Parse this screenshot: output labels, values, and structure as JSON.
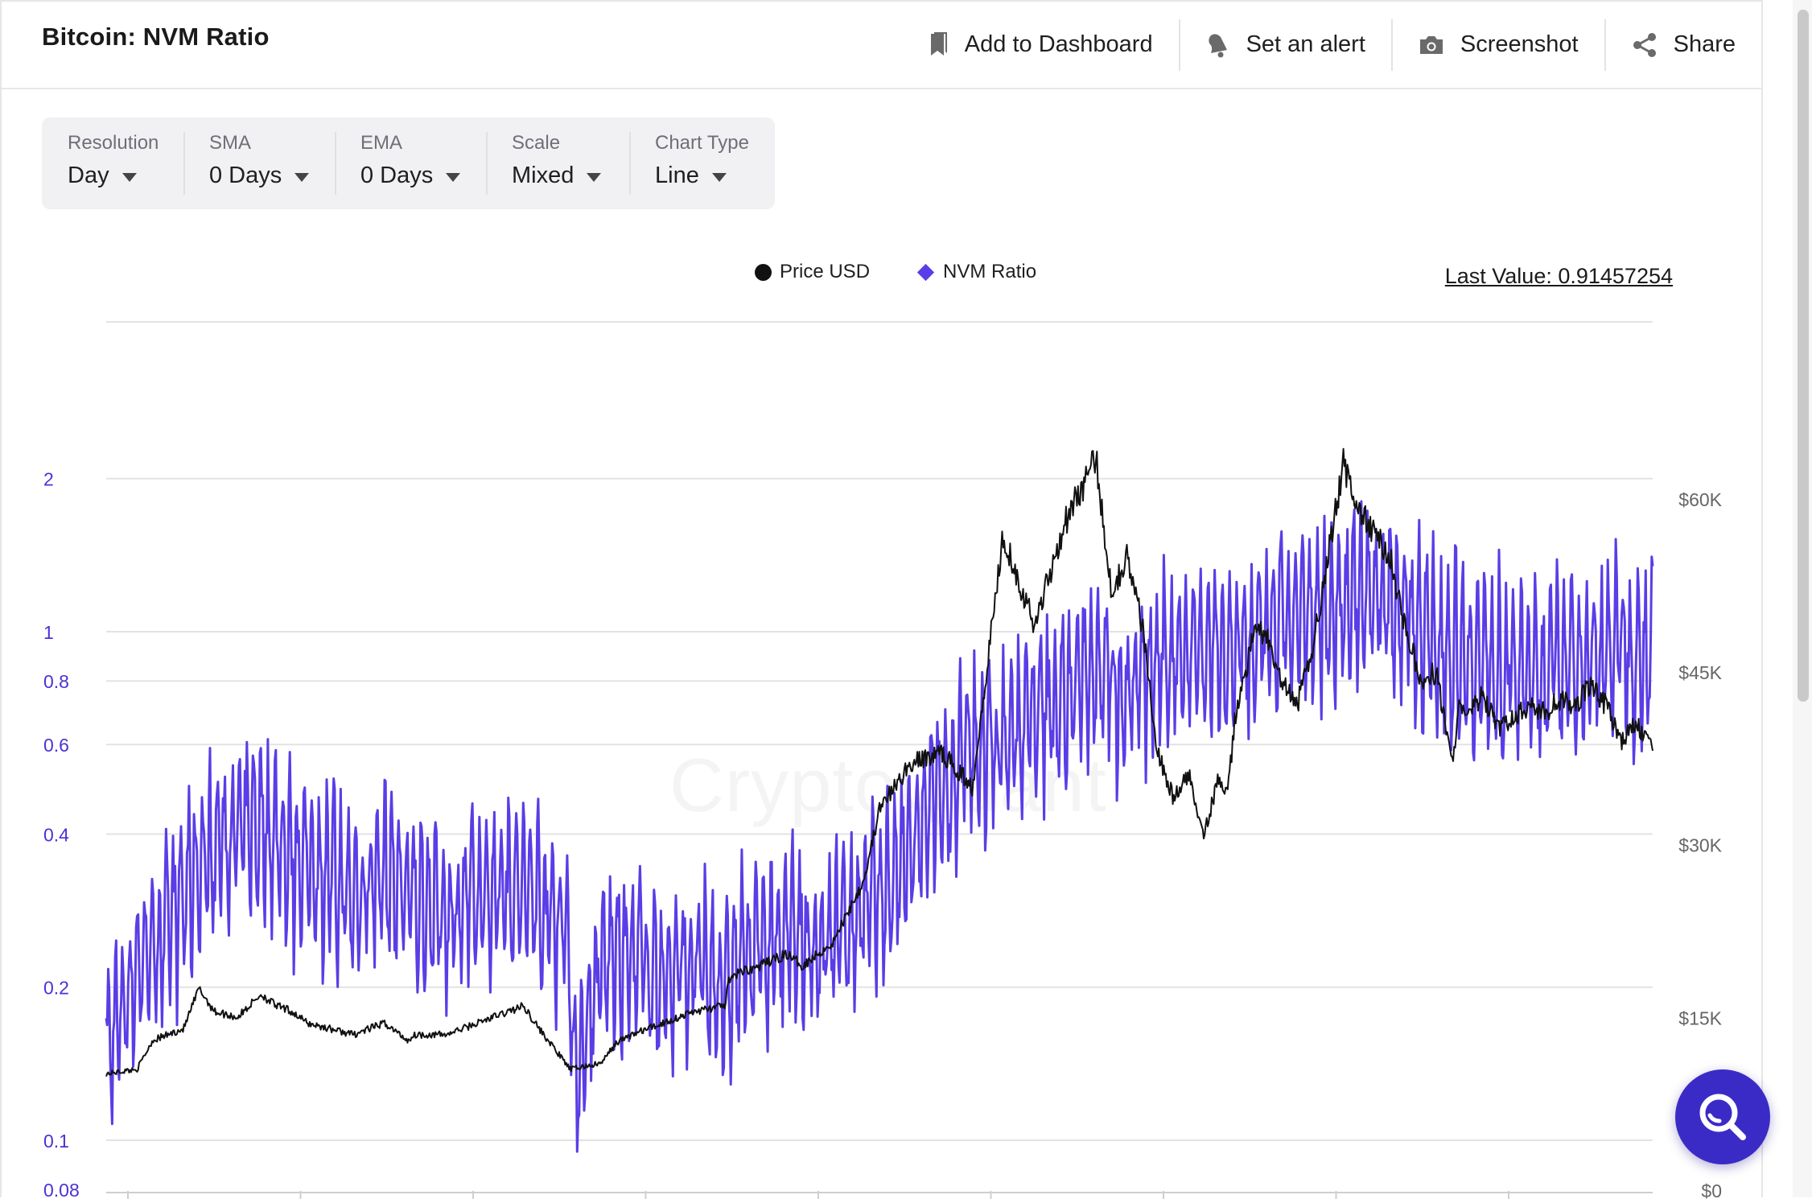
{
  "header": {
    "title": "Bitcoin: NVM Ratio",
    "actions": [
      {
        "label": "Add to Dashboard",
        "icon": "bookmark-icon"
      },
      {
        "label": "Set an alert",
        "icon": "bell-icon"
      },
      {
        "label": "Screenshot",
        "icon": "camera-icon"
      },
      {
        "label": "Share",
        "icon": "share-icon"
      }
    ]
  },
  "controls": [
    {
      "label": "Resolution",
      "value": "Day"
    },
    {
      "label": "SMA",
      "value": "0 Days"
    },
    {
      "label": "EMA",
      "value": "0 Days"
    },
    {
      "label": "Scale",
      "value": "Mixed"
    },
    {
      "label": "Chart Type",
      "value": "Line"
    }
  ],
  "legend": {
    "price": "Price USD",
    "nvm": "NVM Ratio"
  },
  "last_value": "Last Value: 0.91457254",
  "watermark": "CryptoQuant",
  "colors": {
    "nvm": "#5a3de6",
    "price": "#111111",
    "axis_left": "#4a32d6",
    "axis_right": "#666666",
    "grid": "#e3e3e3",
    "fab": "#3b2bc6"
  },
  "chart_data": {
    "type": "line",
    "scale": "mixed",
    "left_axis": {
      "scale": "log",
      "ticks": [
        0.08,
        0.1,
        0.2,
        0.4,
        0.6,
        0.8,
        1,
        2
      ],
      "labels": [
        "0.08",
        "0.1",
        "0.2",
        "0.4",
        "0.6",
        "0.8",
        "1",
        "2"
      ]
    },
    "right_axis": {
      "scale": "linear",
      "ticks": [
        0,
        15000,
        30000,
        45000,
        60000
      ],
      "labels": [
        "$0",
        "$15K",
        "$30K",
        "$45K",
        "$60K"
      ],
      "range": [
        0,
        60000
      ]
    },
    "grid": true,
    "series": [
      {
        "name": "Price USD",
        "axis": "right",
        "x": [
          0,
          0.02,
          0.03,
          0.05,
          0.06,
          0.065,
          0.07,
          0.085,
          0.1,
          0.11,
          0.12,
          0.13,
          0.145,
          0.16,
          0.18,
          0.195,
          0.2,
          0.22,
          0.24,
          0.27,
          0.28,
          0.3,
          0.32,
          0.33,
          0.34,
          0.36,
          0.37,
          0.38,
          0.4,
          0.402,
          0.41,
          0.42,
          0.44,
          0.45,
          0.47,
          0.49,
          0.5,
          0.52,
          0.54,
          0.56,
          0.58,
          0.6,
          0.62,
          0.64,
          0.65,
          0.66,
          0.67,
          0.68,
          0.69,
          0.7,
          0.71,
          0.72,
          0.725,
          0.73,
          0.74,
          0.745,
          0.75,
          0.76,
          0.77,
          0.78,
          0.79,
          0.8,
          0.81,
          0.82,
          0.83,
          0.84,
          0.85,
          0.86,
          0.87,
          0.875,
          0.88,
          0.89,
          0.9,
          0.91,
          0.92,
          0.93,
          0.94,
          0.95,
          0.96,
          0.97,
          0.98,
          0.99,
          1.0
        ],
        "values": [
          10100,
          10500,
          13000,
          14000,
          17500,
          16500,
          15500,
          15000,
          17000,
          16000,
          15500,
          14500,
          14000,
          13500,
          14500,
          13000,
          13500,
          13500,
          14500,
          16000,
          14000,
          10500,
          11000,
          12800,
          13500,
          14500,
          15000,
          15500,
          16000,
          18000,
          19000,
          19300,
          20500,
          19500,
          21500,
          27000,
          33000,
          37000,
          38000,
          35000,
          57000,
          49000,
          58000,
          63500,
          52000,
          55000,
          49000,
          38000,
          34000,
          36000,
          31000,
          36000,
          34000,
          41000,
          47000,
          49000,
          48000,
          44000,
          42000,
          47000,
          55000,
          63000,
          59000,
          57000,
          55000,
          49000,
          44000,
          45000,
          37000,
          42000,
          41000,
          43000,
          40000,
          41000,
          42000,
          41500,
          42500,
          42000,
          44000,
          42000,
          39000,
          40500,
          38000
        ]
      },
      {
        "name": "NVM Ratio",
        "axis": "left",
        "x": [
          0,
          0.02,
          0.04,
          0.06,
          0.08,
          0.1,
          0.12,
          0.14,
          0.16,
          0.18,
          0.2,
          0.22,
          0.24,
          0.26,
          0.28,
          0.3,
          0.302,
          0.32,
          0.34,
          0.36,
          0.38,
          0.4,
          0.42,
          0.44,
          0.46,
          0.48,
          0.5,
          0.52,
          0.54,
          0.56,
          0.58,
          0.6,
          0.62,
          0.64,
          0.66,
          0.68,
          0.7,
          0.72,
          0.74,
          0.76,
          0.78,
          0.8,
          0.82,
          0.84,
          0.86,
          0.88,
          0.9,
          0.92,
          0.94,
          0.96,
          0.98,
          1.0
        ],
        "values": [
          0.15,
          0.22,
          0.26,
          0.35,
          0.4,
          0.42,
          0.36,
          0.34,
          0.3,
          0.34,
          0.3,
          0.28,
          0.3,
          0.32,
          0.3,
          0.26,
          0.13,
          0.22,
          0.23,
          0.21,
          0.22,
          0.2,
          0.24,
          0.25,
          0.24,
          0.27,
          0.3,
          0.36,
          0.48,
          0.58,
          0.6,
          0.68,
          0.72,
          0.9,
          0.75,
          0.85,
          0.95,
          0.9,
          0.92,
          1.05,
          1.05,
          1.15,
          1.2,
          1.1,
          0.95,
          0.9,
          0.85,
          0.82,
          0.85,
          0.9,
          0.95,
          0.91
        ]
      }
    ]
  }
}
